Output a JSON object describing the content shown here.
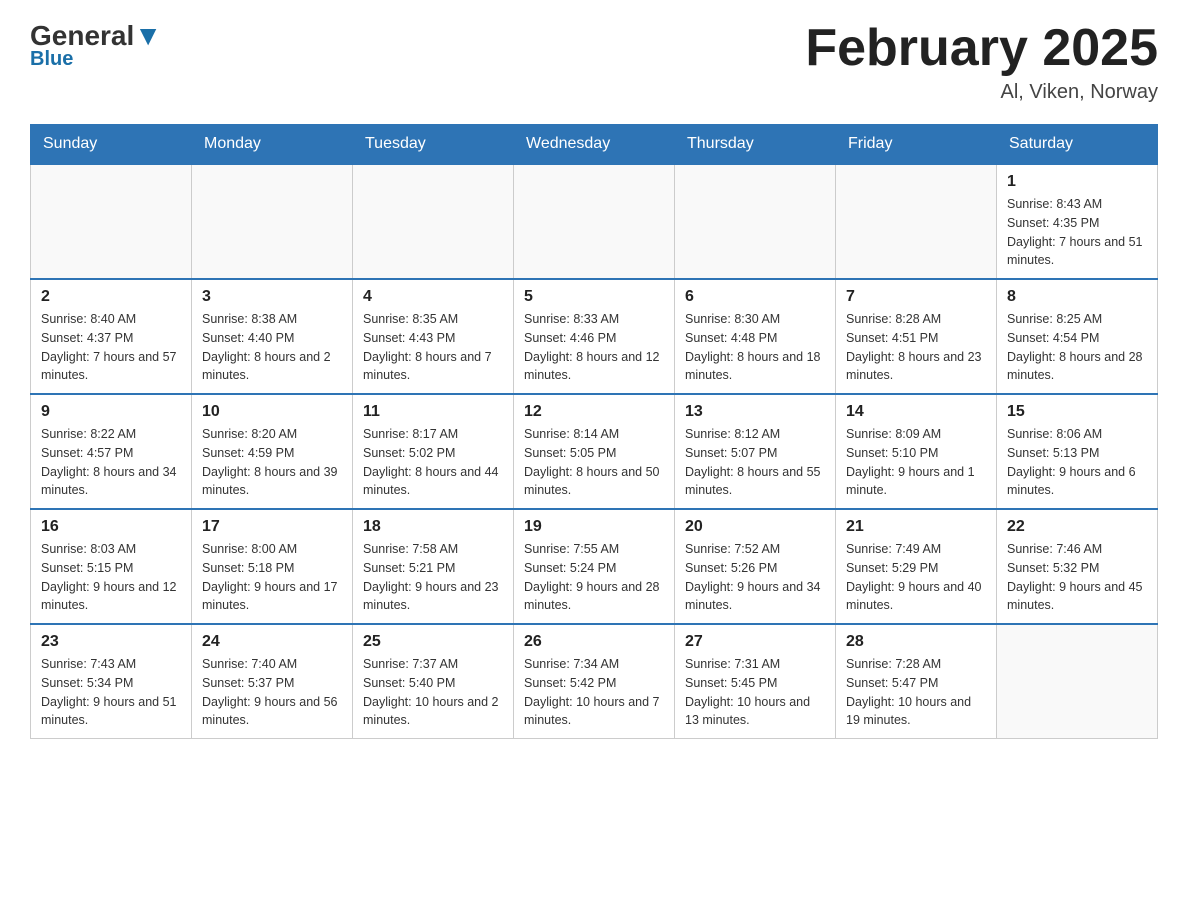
{
  "header": {
    "logo_general": "General",
    "logo_blue": "Blue",
    "month_title": "February 2025",
    "location": "Al, Viken, Norway"
  },
  "weekdays": [
    "Sunday",
    "Monday",
    "Tuesday",
    "Wednesday",
    "Thursday",
    "Friday",
    "Saturday"
  ],
  "weeks": [
    [
      {
        "day": "",
        "info": ""
      },
      {
        "day": "",
        "info": ""
      },
      {
        "day": "",
        "info": ""
      },
      {
        "day": "",
        "info": ""
      },
      {
        "day": "",
        "info": ""
      },
      {
        "day": "",
        "info": ""
      },
      {
        "day": "1",
        "info": "Sunrise: 8:43 AM\nSunset: 4:35 PM\nDaylight: 7 hours\nand 51 minutes."
      }
    ],
    [
      {
        "day": "2",
        "info": "Sunrise: 8:40 AM\nSunset: 4:37 PM\nDaylight: 7 hours\nand 57 minutes."
      },
      {
        "day": "3",
        "info": "Sunrise: 8:38 AM\nSunset: 4:40 PM\nDaylight: 8 hours\nand 2 minutes."
      },
      {
        "day": "4",
        "info": "Sunrise: 8:35 AM\nSunset: 4:43 PM\nDaylight: 8 hours\nand 7 minutes."
      },
      {
        "day": "5",
        "info": "Sunrise: 8:33 AM\nSunset: 4:46 PM\nDaylight: 8 hours\nand 12 minutes."
      },
      {
        "day": "6",
        "info": "Sunrise: 8:30 AM\nSunset: 4:48 PM\nDaylight: 8 hours\nand 18 minutes."
      },
      {
        "day": "7",
        "info": "Sunrise: 8:28 AM\nSunset: 4:51 PM\nDaylight: 8 hours\nand 23 minutes."
      },
      {
        "day": "8",
        "info": "Sunrise: 8:25 AM\nSunset: 4:54 PM\nDaylight: 8 hours\nand 28 minutes."
      }
    ],
    [
      {
        "day": "9",
        "info": "Sunrise: 8:22 AM\nSunset: 4:57 PM\nDaylight: 8 hours\nand 34 minutes."
      },
      {
        "day": "10",
        "info": "Sunrise: 8:20 AM\nSunset: 4:59 PM\nDaylight: 8 hours\nand 39 minutes."
      },
      {
        "day": "11",
        "info": "Sunrise: 8:17 AM\nSunset: 5:02 PM\nDaylight: 8 hours\nand 44 minutes."
      },
      {
        "day": "12",
        "info": "Sunrise: 8:14 AM\nSunset: 5:05 PM\nDaylight: 8 hours\nand 50 minutes."
      },
      {
        "day": "13",
        "info": "Sunrise: 8:12 AM\nSunset: 5:07 PM\nDaylight: 8 hours\nand 55 minutes."
      },
      {
        "day": "14",
        "info": "Sunrise: 8:09 AM\nSunset: 5:10 PM\nDaylight: 9 hours\nand 1 minute."
      },
      {
        "day": "15",
        "info": "Sunrise: 8:06 AM\nSunset: 5:13 PM\nDaylight: 9 hours\nand 6 minutes."
      }
    ],
    [
      {
        "day": "16",
        "info": "Sunrise: 8:03 AM\nSunset: 5:15 PM\nDaylight: 9 hours\nand 12 minutes."
      },
      {
        "day": "17",
        "info": "Sunrise: 8:00 AM\nSunset: 5:18 PM\nDaylight: 9 hours\nand 17 minutes."
      },
      {
        "day": "18",
        "info": "Sunrise: 7:58 AM\nSunset: 5:21 PM\nDaylight: 9 hours\nand 23 minutes."
      },
      {
        "day": "19",
        "info": "Sunrise: 7:55 AM\nSunset: 5:24 PM\nDaylight: 9 hours\nand 28 minutes."
      },
      {
        "day": "20",
        "info": "Sunrise: 7:52 AM\nSunset: 5:26 PM\nDaylight: 9 hours\nand 34 minutes."
      },
      {
        "day": "21",
        "info": "Sunrise: 7:49 AM\nSunset: 5:29 PM\nDaylight: 9 hours\nand 40 minutes."
      },
      {
        "day": "22",
        "info": "Sunrise: 7:46 AM\nSunset: 5:32 PM\nDaylight: 9 hours\nand 45 minutes."
      }
    ],
    [
      {
        "day": "23",
        "info": "Sunrise: 7:43 AM\nSunset: 5:34 PM\nDaylight: 9 hours\nand 51 minutes."
      },
      {
        "day": "24",
        "info": "Sunrise: 7:40 AM\nSunset: 5:37 PM\nDaylight: 9 hours\nand 56 minutes."
      },
      {
        "day": "25",
        "info": "Sunrise: 7:37 AM\nSunset: 5:40 PM\nDaylight: 10 hours\nand 2 minutes."
      },
      {
        "day": "26",
        "info": "Sunrise: 7:34 AM\nSunset: 5:42 PM\nDaylight: 10 hours\nand 7 minutes."
      },
      {
        "day": "27",
        "info": "Sunrise: 7:31 AM\nSunset: 5:45 PM\nDaylight: 10 hours\nand 13 minutes."
      },
      {
        "day": "28",
        "info": "Sunrise: 7:28 AM\nSunset: 5:47 PM\nDaylight: 10 hours\nand 19 minutes."
      },
      {
        "day": "",
        "info": ""
      }
    ]
  ]
}
